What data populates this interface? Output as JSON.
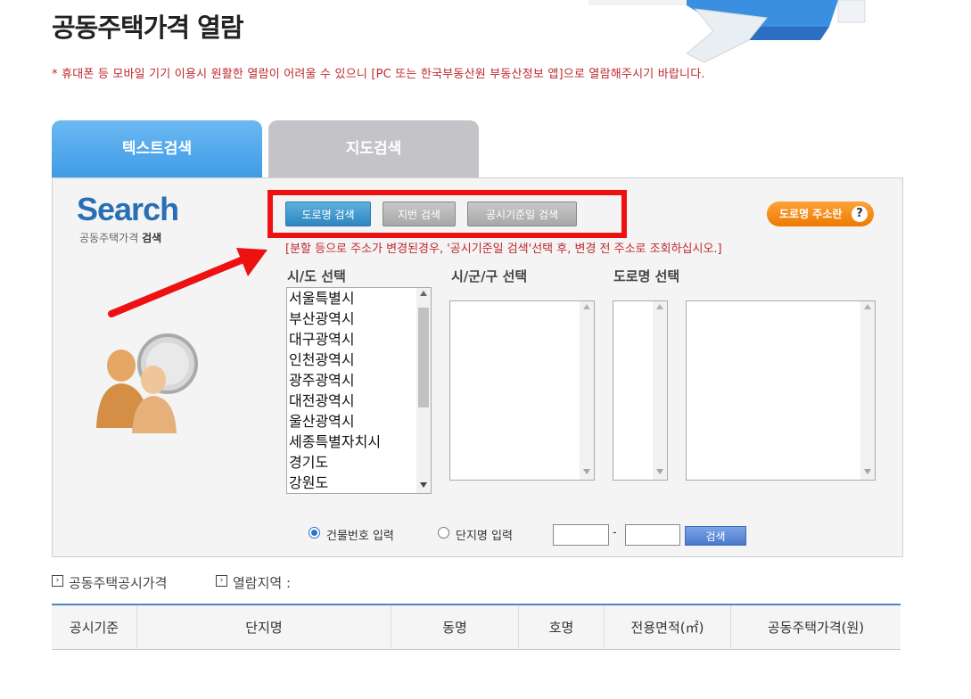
{
  "header": {
    "title": "공동주택가격 열람",
    "notice": "* 휴대폰 등 모바일 기기 이용시 원활한 열람이 어려울 수 있으니 [PC 또는 한국부동산원 부동산정보 앱]으로 열람해주시기 바랍니다."
  },
  "tabs": [
    {
      "label": "텍스트검색",
      "active": true
    },
    {
      "label": "지도검색",
      "active": false
    }
  ],
  "logo": {
    "title": "Search",
    "subtitle_plain": "공동주택가격",
    "subtitle_bold": "검색"
  },
  "search_buttons": {
    "road": "도로명 검색",
    "lot": "지번 검색",
    "date": "공시기준일 검색"
  },
  "road_address_button": {
    "label": "도로명 주소란",
    "help": "?"
  },
  "red_notice": "[분할 등으로 주소가 변경된경우, '공시기준일 검색'선택 후, 변경 전 주소로 조회하십시오.]",
  "selectors": {
    "sido_label": "시/도 선택",
    "gu_label": "시/군/구 선택",
    "road_label": "도로명 선택"
  },
  "sido_options": [
    "서울특별시",
    "부산광역시",
    "대구광역시",
    "인천광역시",
    "광주광역시",
    "대전광역시",
    "울산광역시",
    "세종특별자치시",
    "경기도",
    "강원도"
  ],
  "options": {
    "building_number": "건물번호 입력",
    "complex_name": "단지명 입력",
    "selected": "building_number",
    "separator": "-",
    "search_button": "검색"
  },
  "info": {
    "price_label": "공동주택공시가격",
    "region_label": "열람지역 :"
  },
  "table": {
    "columns": [
      "공시기준",
      "단지명",
      "동명",
      "호명",
      "전용면적(㎡)",
      "공동주택가격(원)"
    ]
  },
  "colors": {
    "accent": "#3f9be6",
    "highlight": "#ee1111",
    "notice": "#c0282d",
    "orange": "#ec7a00"
  }
}
